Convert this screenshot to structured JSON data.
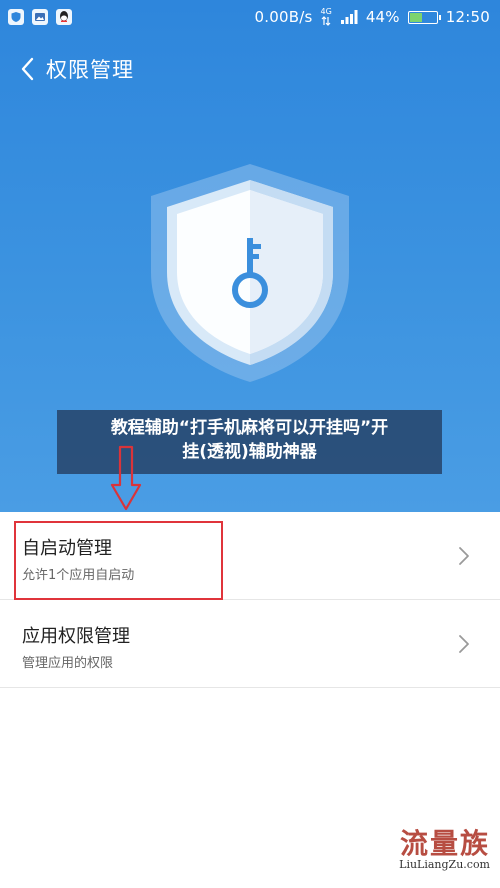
{
  "status_bar": {
    "network_speed": "0.00B/s",
    "signal_label": "4G",
    "battery_percent": "44%",
    "battery_level": 0.44,
    "time": "12:50",
    "icons": [
      "security-app-icon",
      "gallery-app-icon",
      "qq-app-icon",
      "signal-icon",
      "battery-icon"
    ]
  },
  "nav": {
    "title": "权限管理"
  },
  "caption": {
    "line1": "教程辅助“打手机麻将可以开挂吗”开",
    "line2": "挂(透视)辅助神器"
  },
  "list": {
    "items": [
      {
        "title": "自启动管理",
        "subtitle": "允许1个应用自启动"
      },
      {
        "title": "应用权限管理",
        "subtitle": "管理应用的权限"
      }
    ]
  },
  "colors": {
    "hero_blue": "#3c93e0",
    "highlight_red": "#e0343b",
    "battery_green": "#7dd36f"
  },
  "watermark": {
    "logo": "流量族",
    "url": "LiuLiangZu.com"
  }
}
